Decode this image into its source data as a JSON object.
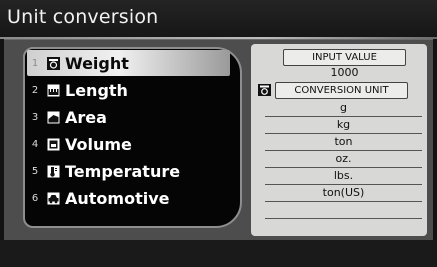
{
  "title": "Unit conversion",
  "menu": {
    "items": [
      {
        "num": "1",
        "label": "Weight",
        "icon": "scale-icon"
      },
      {
        "num": "2",
        "label": "Length",
        "icon": "ruler-icon"
      },
      {
        "num": "3",
        "label": "Area",
        "icon": "area-icon"
      },
      {
        "num": "4",
        "label": "Volume",
        "icon": "container-icon"
      },
      {
        "num": "5",
        "label": "Temperature",
        "icon": "thermometer-icon"
      },
      {
        "num": "6",
        "label": "Automotive",
        "icon": "car-icon"
      }
    ]
  },
  "panel": {
    "input_label": "INPUT VALUE",
    "input_value": "1000",
    "conversion_label": "CONVERSION UNIT",
    "units": [
      "g",
      "kg",
      "ton",
      "oz.",
      "lbs.",
      "ton(US)"
    ]
  }
}
